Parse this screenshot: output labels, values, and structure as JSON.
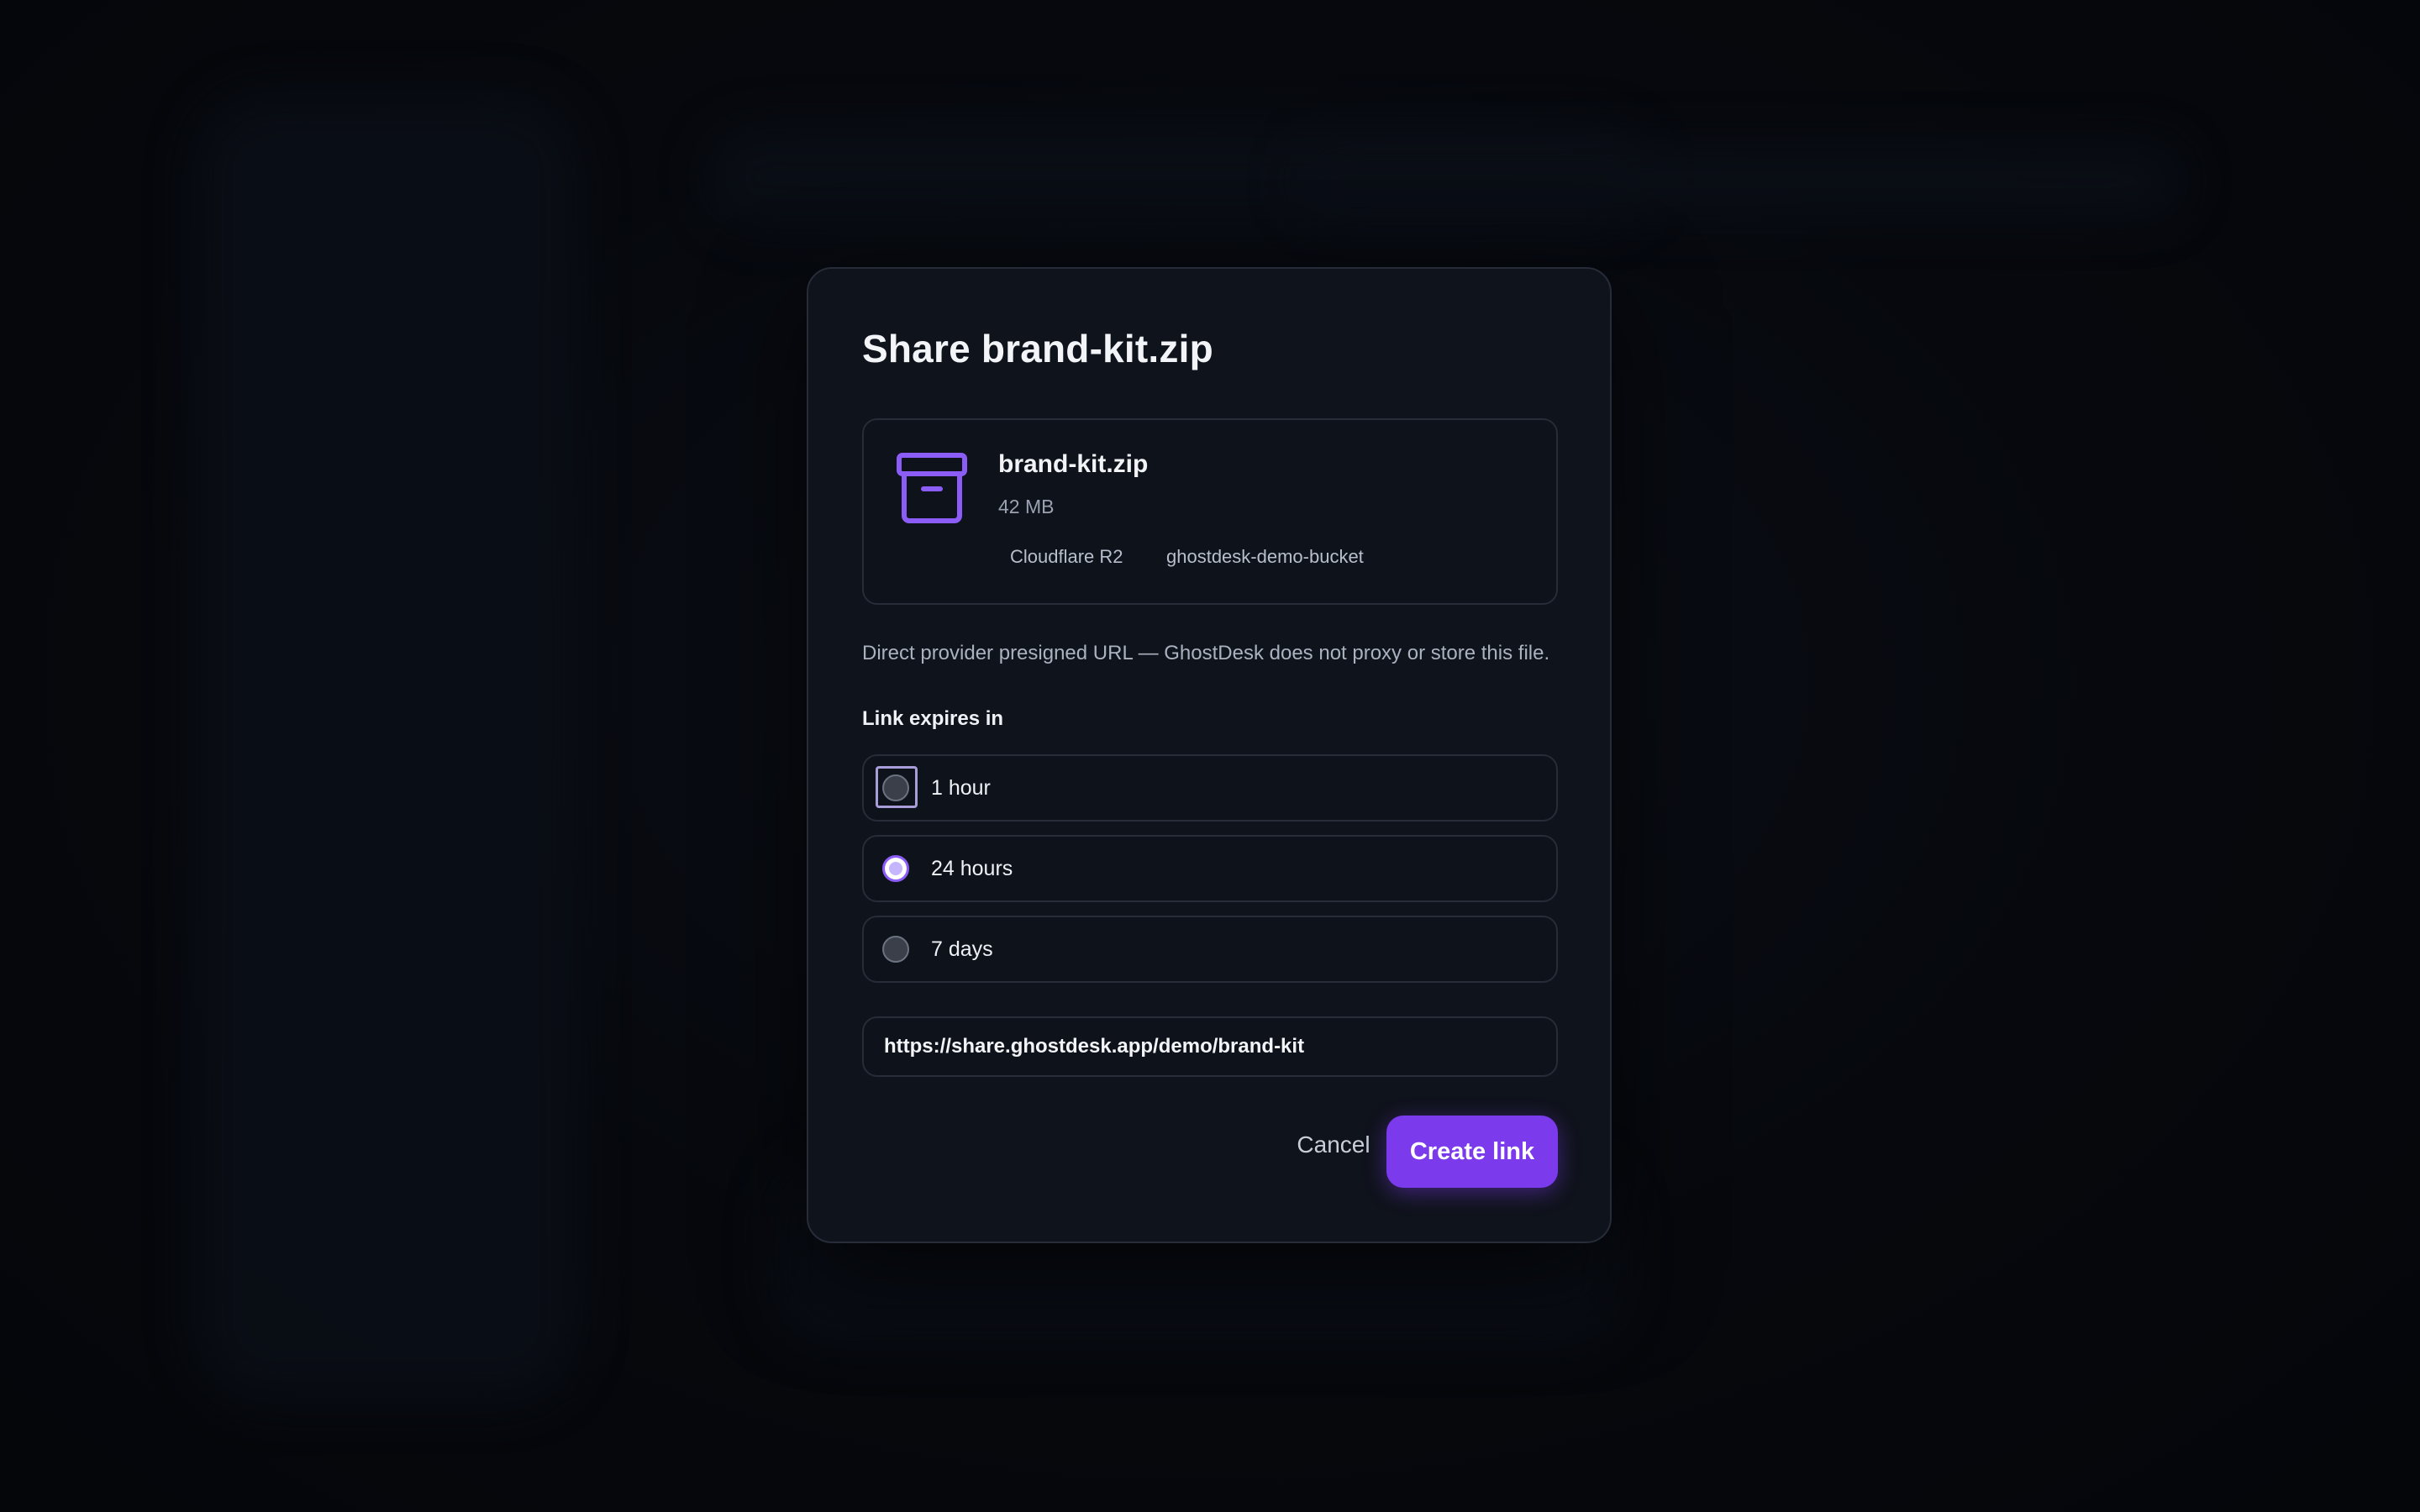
{
  "dialog": {
    "title": "Share brand-kit.zip",
    "file": {
      "icon": "archive-box-icon",
      "name": "brand-kit.zip",
      "size": "42 MB",
      "provider": "Cloudflare R2",
      "bucket": "ghostdesk-demo-bucket"
    },
    "notice": "Direct provider presigned URL — GhostDesk does not proxy or store this file.",
    "expiry": {
      "label": "Link expires in",
      "options": [
        {
          "label": "1 hour",
          "selected": false,
          "focused": true
        },
        {
          "label": "24 hours",
          "selected": true,
          "focused": false
        },
        {
          "label": "7 days",
          "selected": false,
          "focused": false
        }
      ]
    },
    "url_value": "https://share.ghostdesk.app/demo/brand-kit",
    "cancel_label": "Cancel",
    "create_label": "Create link"
  },
  "colors": {
    "accent": "#7c3aed",
    "background": "#05070b",
    "panel": "#0f131b",
    "border": "#262c38"
  }
}
